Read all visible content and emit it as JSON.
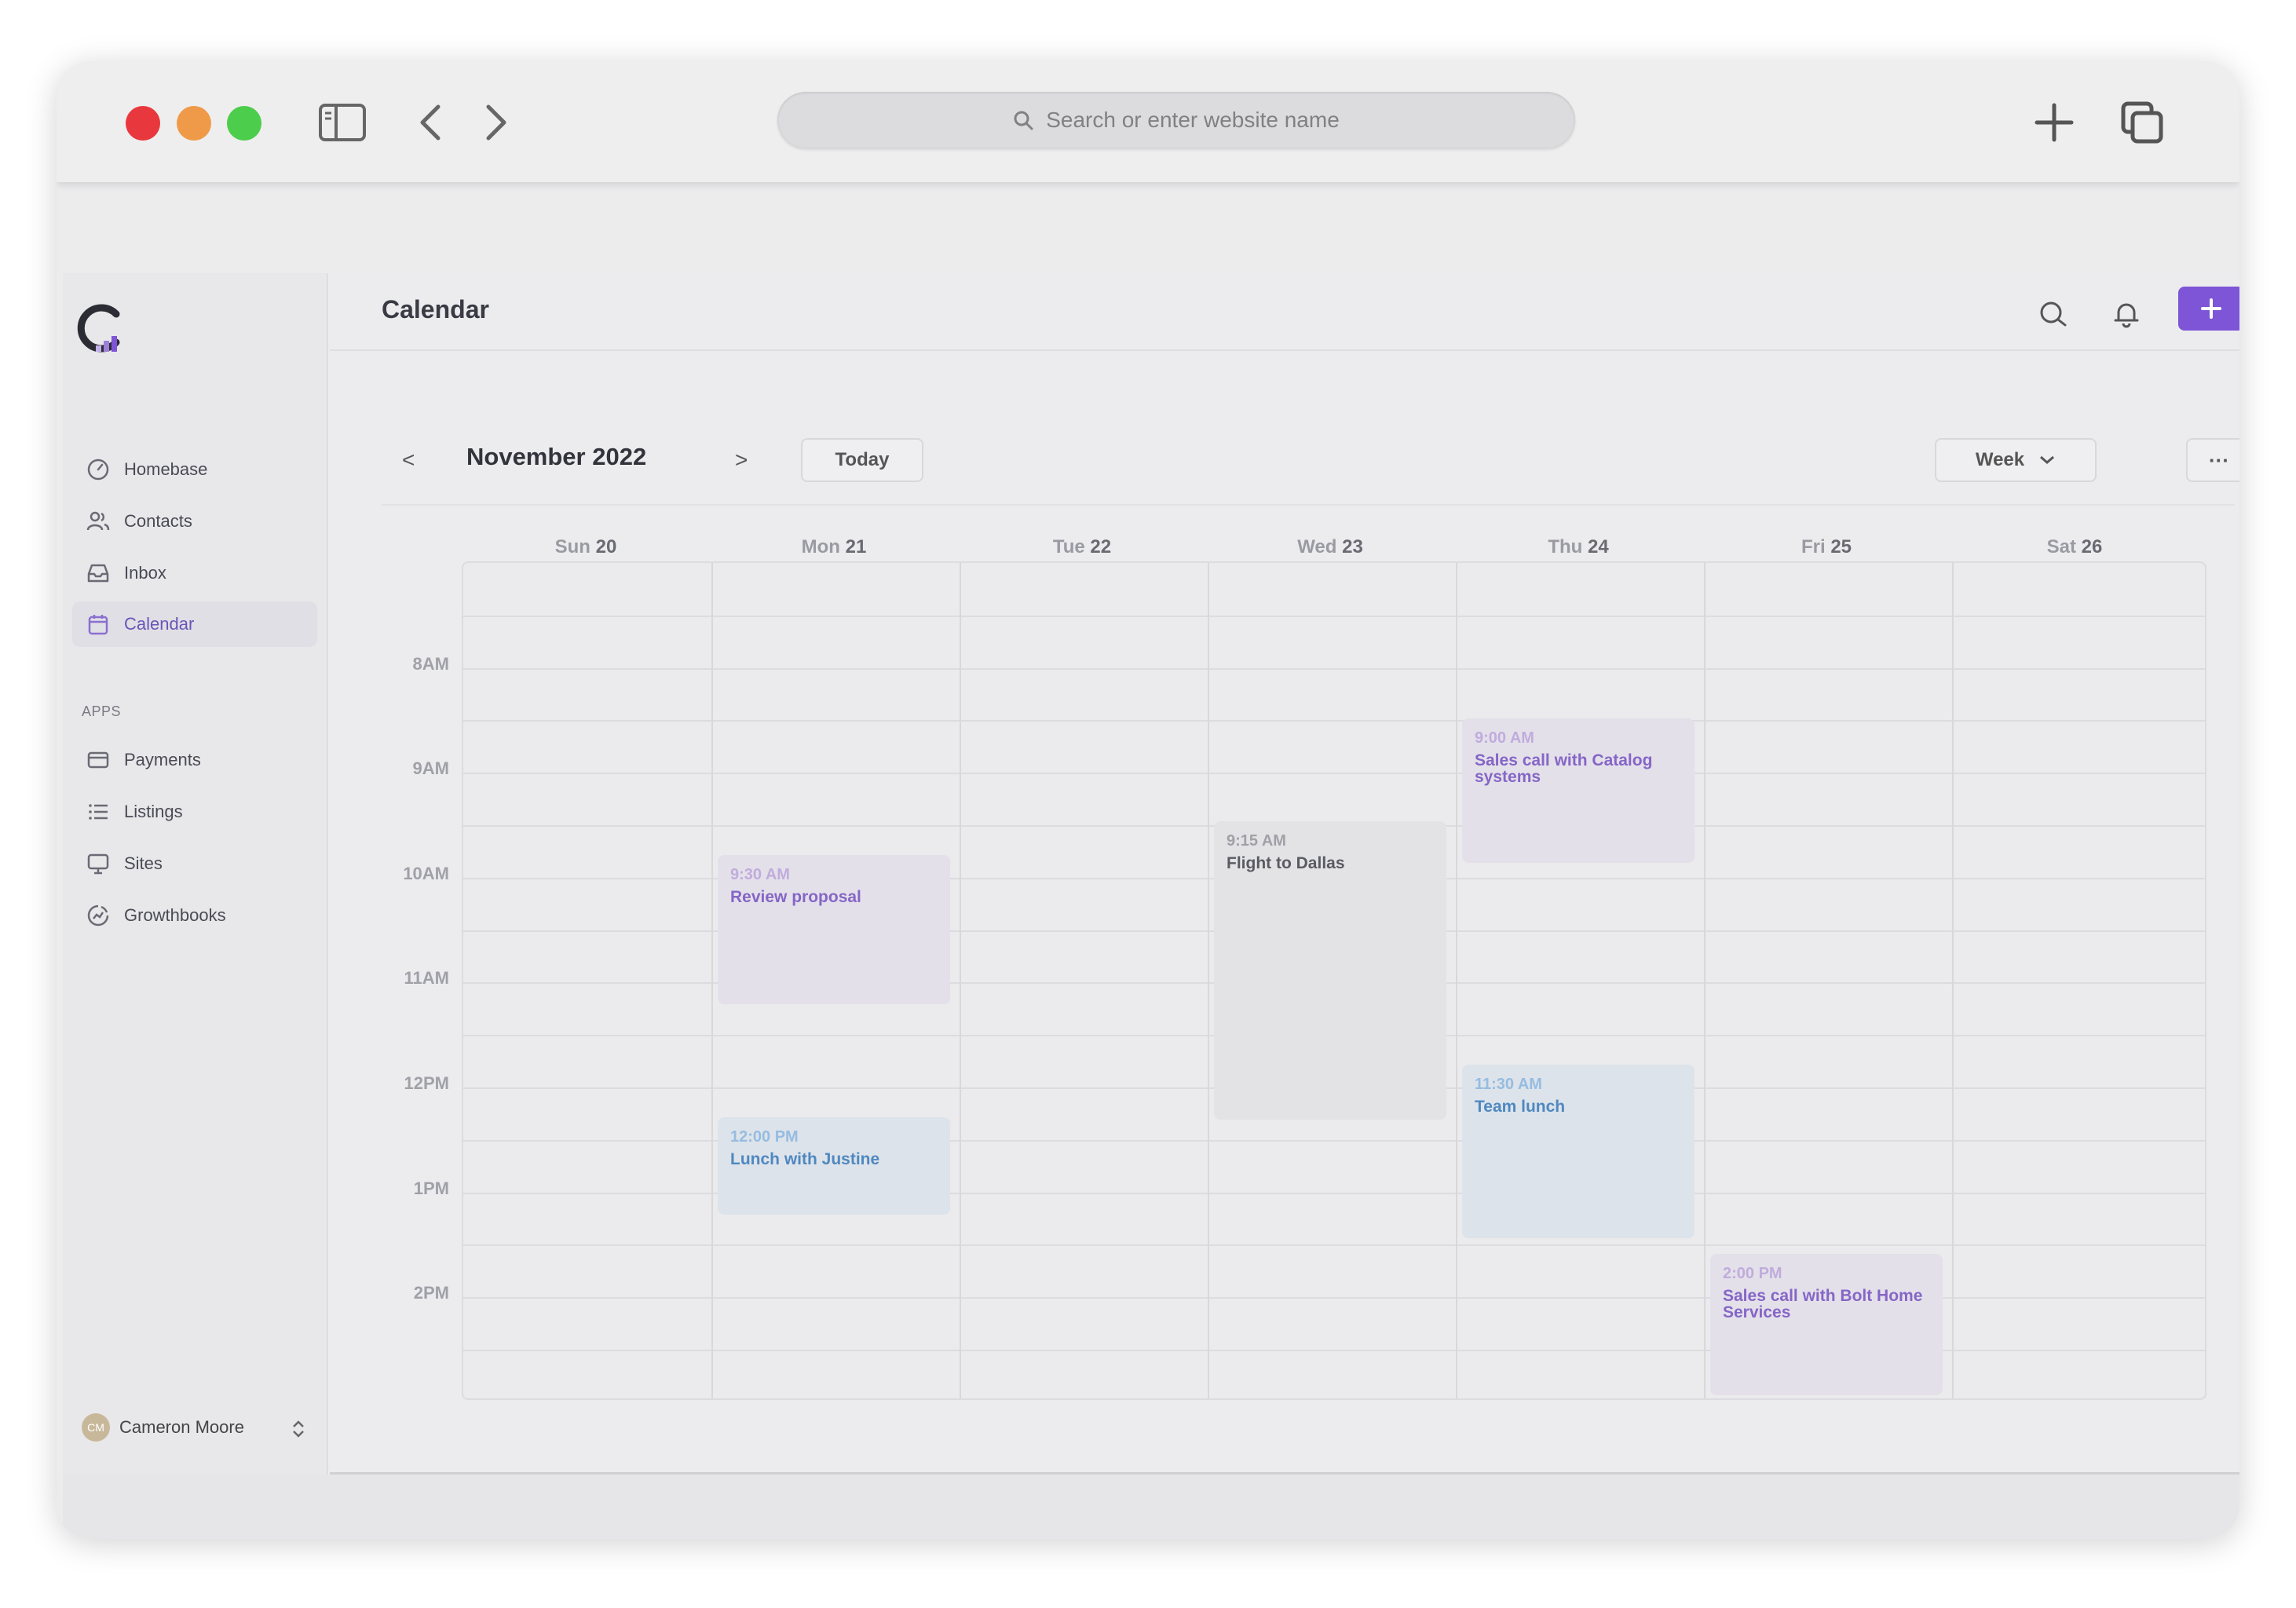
{
  "browser": {
    "url_placeholder": "Search or enter website name",
    "colors": {
      "close": "#e8373d",
      "minimize": "#ef9a48",
      "zoom": "#4ccd4c"
    }
  },
  "sidebar": {
    "items": [
      {
        "label": "Homebase",
        "icon": "dashboard-gauge-icon"
      },
      {
        "label": "Contacts",
        "icon": "users-icon"
      },
      {
        "label": "Inbox",
        "icon": "inbox-tray-icon"
      },
      {
        "label": "Calendar",
        "icon": "calendar-icon",
        "active": true
      }
    ],
    "apps_label": "APPS",
    "apps": [
      {
        "label": "Payments",
        "icon": "credit-card-icon"
      },
      {
        "label": "Listings",
        "icon": "list-icon"
      },
      {
        "label": "Sites",
        "icon": "monitor-icon"
      },
      {
        "label": "Growthbooks",
        "icon": "chart-circle-icon"
      }
    ],
    "user": {
      "initials": "CM",
      "name": "Cameron Moore"
    }
  },
  "header": {
    "title": "Calendar",
    "accent": "#7d55d6"
  },
  "toolbar": {
    "prev": "<",
    "month": "November 2022",
    "next": ">",
    "today": "Today",
    "view": "Week",
    "more": "···"
  },
  "week": {
    "days": [
      {
        "dow": "Sun",
        "num": "20"
      },
      {
        "dow": "Mon",
        "num": "21"
      },
      {
        "dow": "Tue",
        "num": "22"
      },
      {
        "dow": "Wed",
        "num": "23"
      },
      {
        "dow": "Thu",
        "num": "24"
      },
      {
        "dow": "Fri",
        "num": "25"
      },
      {
        "dow": "Sat",
        "num": "26"
      }
    ],
    "hours": [
      "8AM",
      "9AM",
      "10AM",
      "11AM",
      "12PM",
      "1PM",
      "2PM"
    ]
  },
  "events": [
    {
      "time": "9:30 AM",
      "title": "Review proposal",
      "day": 1,
      "color": "purple"
    },
    {
      "time": "12:00 PM",
      "title": "Lunch with Justine",
      "day": 1,
      "color": "blue"
    },
    {
      "time": "9:15 AM",
      "title": "Flight to Dallas",
      "day": 3,
      "color": "gray"
    },
    {
      "time": "9:00 AM",
      "title": "Sales call with Catalog systems",
      "day": 4,
      "color": "purple"
    },
    {
      "time": "11:30 AM",
      "title": "Team lunch",
      "day": 4,
      "color": "blue"
    },
    {
      "time": "2:00 PM",
      "title": "Sales call with Bolt Home Services",
      "day": 5,
      "color": "purple"
    }
  ]
}
